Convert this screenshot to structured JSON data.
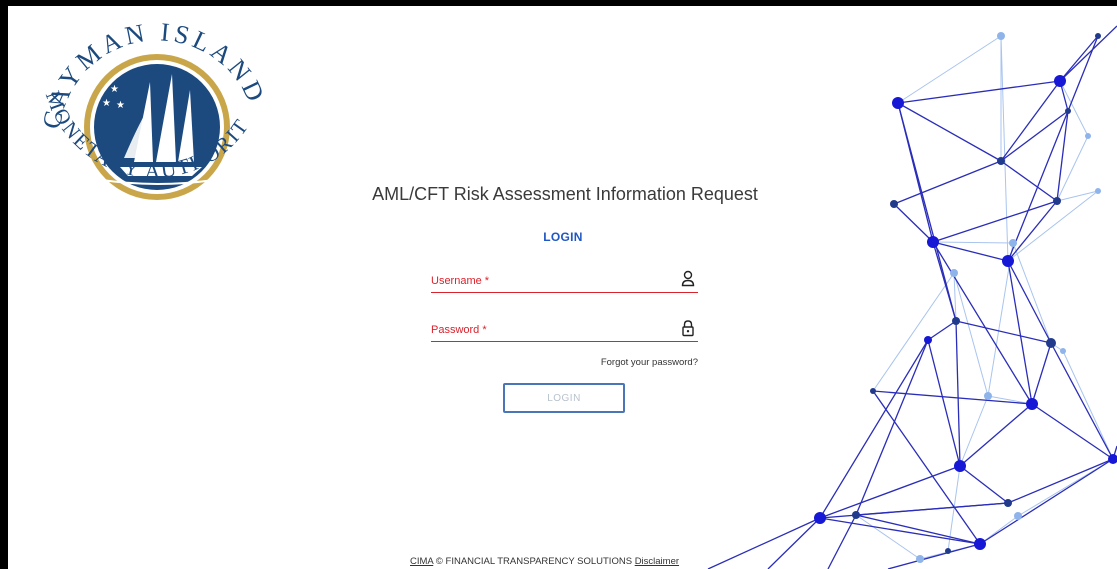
{
  "logo": {
    "text_top": "CAYMAN ISLANDS",
    "text_bottom": "MONETARY AUTHORITY"
  },
  "page": {
    "title": "AML/CFT Risk Assessment Information Request",
    "login_heading": "LOGIN"
  },
  "form": {
    "username_label": "Username *",
    "password_label": "Password *",
    "forgot_password": "Forgot your password?",
    "login_button": "LOGIN"
  },
  "footer": {
    "cima_link": "CIMA",
    "copyright": "© FINANCIAL TRANSPARENCY SOLUTIONS",
    "disclaimer_link": "Disclaimer"
  },
  "colors": {
    "accent": "#1f57c3",
    "error": "#d9232d",
    "logo_navy": "#1c4a7e",
    "logo_gold": "#c9a64a"
  }
}
